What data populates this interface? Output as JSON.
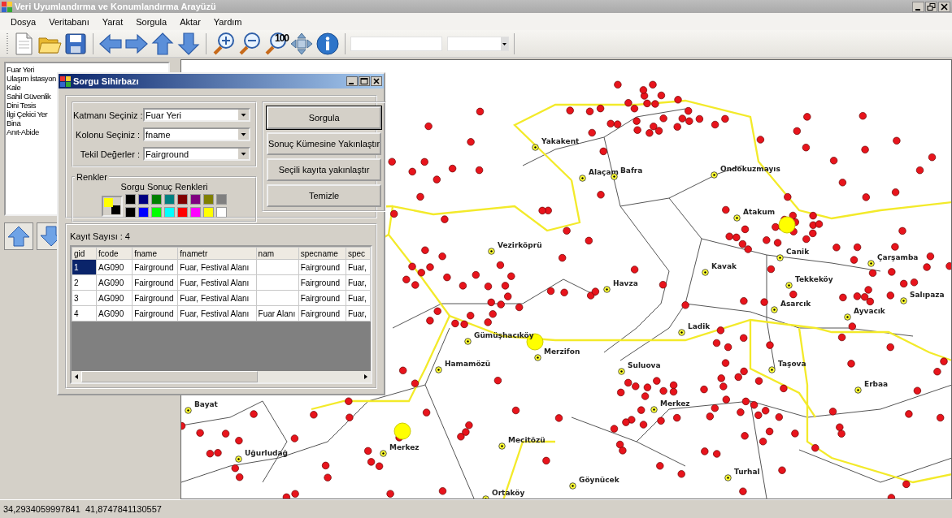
{
  "window": {
    "title": "Veri Uyumlandırma ve Konumlandırma Arayüzü"
  },
  "menu": [
    "Dosya",
    "Veritabanı",
    "Yarat",
    "Sorgula",
    "Aktar",
    "Yardım"
  ],
  "toolbar": {
    "zoom_label": "100"
  },
  "layer_list": {
    "items": [
      "Fuar Yeri",
      "Ulaşım İstasyon",
      "Kale",
      "Sahil Güvenlik",
      "Dini Tesis",
      "İlgi Çekici Yer",
      "Bina",
      "Anıt-Abide"
    ]
  },
  "map": {
    "labels": [
      "Yakakent",
      "Alaçam",
      "Bafra",
      "Ondokuzmayıs",
      "Atakum",
      "Vezirköprü",
      "Havza",
      "Kavak",
      "Canik",
      "Tekkeköy",
      "Çarşamba",
      "Asarcık",
      "Ayvacık",
      "Salıpaza",
      "Ladik",
      "Gümüşhacıköy",
      "Merzifon",
      "Hamamözü",
      "Suluova",
      "Taşova",
      "Erbaa",
      "Merkez",
      "Bayat",
      "Uğurludağ",
      "Merkez",
      "Mecitözü",
      "Göynücek",
      "Turhal",
      "Ortaköy"
    ]
  },
  "dialog": {
    "title": "Sorgu Sihirbazı",
    "fields": [
      {
        "label": "Katmanı Seçiniz :",
        "value": "Fuar Yeri"
      },
      {
        "label": "Kolonu Seçiniz :",
        "value": "fname"
      },
      {
        "label": "Tekil Değerler :",
        "value": "Fairground"
      }
    ],
    "colors": {
      "title": "Renkler",
      "caption": "Sorgu Sonuç Renkleri",
      "selected_colors": [
        {
          "color": "#ffff00"
        },
        {
          "color": "#000000"
        }
      ],
      "palette": [
        {
          "color": "#000000"
        },
        {
          "color": "#000080"
        },
        {
          "color": "#008000"
        },
        {
          "color": "#008080"
        },
        {
          "color": "#800000"
        },
        {
          "color": "#800080"
        },
        {
          "color": "#808000"
        },
        {
          "color": "#808080"
        },
        {
          "color": "#000000"
        },
        {
          "color": "#0000ff"
        },
        {
          "color": "#00ff00"
        },
        {
          "color": "#00ffff"
        },
        {
          "color": "#ff0000"
        },
        {
          "color": "#ff00ff"
        },
        {
          "color": "#ffff00"
        },
        {
          "color": "#ffffff"
        }
      ]
    },
    "buttons": [
      {
        "label": "Sorgula",
        "default": true
      },
      {
        "label": "Sonuç Kümesine Yakınlaştır",
        "default": false
      },
      {
        "label": "Seçili kayıta yakınlaştır",
        "default": false
      },
      {
        "label": "Temizle",
        "default": false
      }
    ],
    "record_count": "Kayıt Sayısı : 4",
    "table": {
      "columns": [
        "gid",
        "fcode",
        "fname",
        "fnametr",
        "nam",
        "specname",
        "spec"
      ],
      "rows": [
        {
          "selected": true,
          "cells": [
            "1",
            "AG090",
            "Fairground",
            "Fuar, Festival Alanı",
            "",
            "Fairground",
            "Fuar,"
          ]
        },
        {
          "selected": false,
          "cells": [
            "2",
            "AG090",
            "Fairground",
            "Fuar, Festival Alanı",
            "",
            "Fairground",
            "Fuar,"
          ]
        },
        {
          "selected": false,
          "cells": [
            "3",
            "AG090",
            "Fairground",
            "Fuar, Festival Alanı",
            "",
            "Fairground",
            "Fuar,"
          ]
        },
        {
          "selected": false,
          "cells": [
            "4",
            "AG090",
            "Fairground",
            "Fuar, Festival Alanı",
            "Fuar Alanı",
            "Fairground",
            "Fuar,"
          ]
        }
      ]
    }
  },
  "status_bar": {
    "coordinates": "34,2934059997841  41,8747841130557"
  }
}
